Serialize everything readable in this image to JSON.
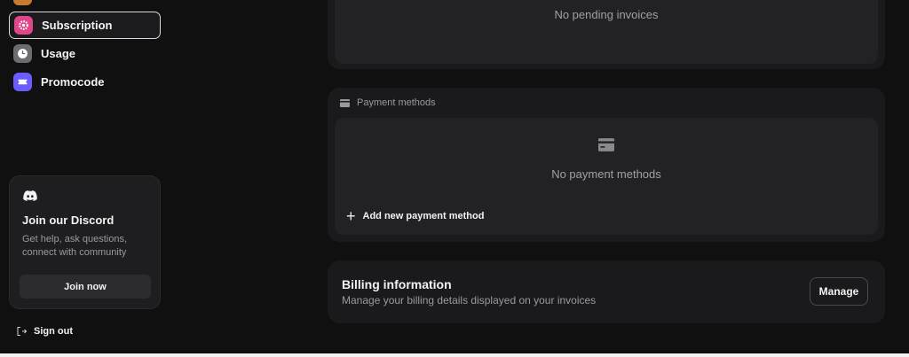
{
  "sidebar": {
    "items": [
      {
        "label": "Subscription",
        "icon": "gear-icon",
        "color": "#e0468a",
        "active": true
      },
      {
        "label": "Usage",
        "icon": "clock-icon",
        "color": "#6b6b70",
        "active": false
      },
      {
        "label": "Promocode",
        "icon": "ticket-icon",
        "color": "#6a5cff",
        "active": false
      }
    ],
    "discord": {
      "icon": "discord-icon",
      "title": "Join our Discord",
      "description": "Get help, ask questions, connect with community",
      "button_label": "Join now"
    },
    "sign_out_label": "Sign out"
  },
  "main": {
    "invoices": {
      "empty_text": "No pending invoices"
    },
    "payment_methods": {
      "title": "Payment methods",
      "empty_text": "No payment methods",
      "add_label": "Add new payment method"
    },
    "billing": {
      "title": "Billing information",
      "description": "Manage your billing details displayed on your invoices",
      "manage_label": "Manage"
    }
  }
}
